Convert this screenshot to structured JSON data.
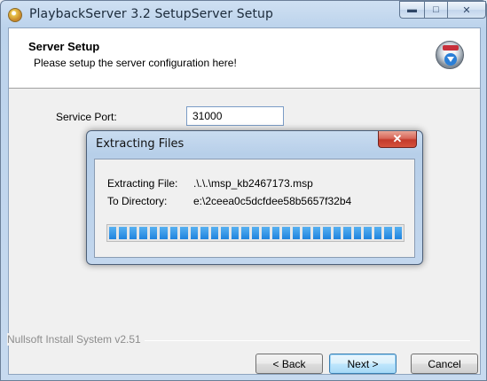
{
  "window": {
    "title": "PlaybackServer 3.2 SetupServer Setup"
  },
  "header": {
    "title": "Server Setup",
    "subtitle": "Please setup the server configuration here!"
  },
  "form": {
    "port_label": "Service Port:",
    "port_value": "31000"
  },
  "dialog": {
    "title": "Extracting Files",
    "file_label": "Extracting File:",
    "file_value": ".\\.\\.\\msp_kb2467173.msp",
    "dir_label": "To Directory:",
    "dir_value": "e:\\2ceea0c5dcfdee58b5657f32b4",
    "progress_segments": 29,
    "progress_fraction": 1.0,
    "accent_color": "#1f83de"
  },
  "footer": {
    "brand": "Nullsoft Install System v2.51"
  },
  "buttons": {
    "back": "< Back",
    "next": "Next >",
    "cancel": "Cancel"
  }
}
